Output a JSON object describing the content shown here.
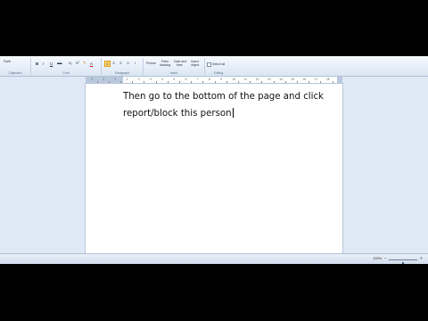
{
  "ribbon": {
    "font_name": "Parth",
    "groups": {
      "clipboard": "Clipboard",
      "font": "Font",
      "paragraph": "Paragraph",
      "insert": "Insert",
      "editing": "Editing"
    },
    "format_buttons": {
      "bold": "B",
      "italic": "I",
      "underline": "U",
      "strikethrough": "abc",
      "font_color": "A"
    },
    "insert_buttons": {
      "picture": "Picture",
      "paint_drawing_1": "Paint",
      "paint_drawing_2": "drawing",
      "date_time_1": "Date and",
      "date_time_2": "time",
      "insert_object_1": "Insert",
      "insert_object_2": "object"
    },
    "select_all": "Select all"
  },
  "ruler": {
    "numbers": [
      "2",
      "1",
      "1",
      "1",
      "2",
      "3",
      "4",
      "5",
      "6",
      "7",
      "8",
      "9",
      "10",
      "11",
      "12",
      "13",
      "14",
      "15",
      "16",
      "17",
      "18"
    ]
  },
  "document": {
    "lines": [
      "Then go to the bottom of the page and click",
      "report/block this person"
    ]
  },
  "statusbar": {
    "zoom": "100%",
    "zoom_out": "−",
    "zoom_in": "+",
    "zoom_level": 0.5
  },
  "colors": {
    "ribbon": "#dbe6f3",
    "app_background": "#dfe9f5",
    "page": "#ffffff",
    "highlight_button": "#ffd76a"
  }
}
